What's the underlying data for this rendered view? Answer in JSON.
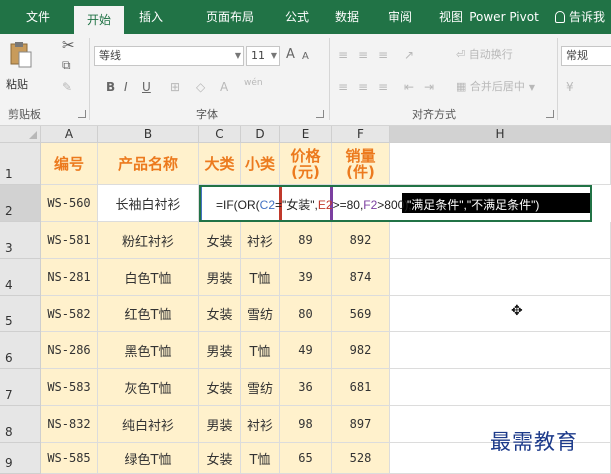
{
  "ribbon_tabs": [
    "文件",
    "开始",
    "插入",
    "页面布局",
    "公式",
    "数据",
    "审阅",
    "视图",
    "Power Pivot",
    "告诉我"
  ],
  "active_tab": "开始",
  "clipboard": {
    "paste_label": "粘贴",
    "group_label": "剪贴板"
  },
  "font": {
    "name": "等线",
    "size": "11",
    "grow": "A",
    "shrink": "A",
    "bold": "B",
    "italic": "I",
    "underline": "U",
    "group_label": "字体",
    "color_a": "A",
    "phonetic": "wén"
  },
  "alignment": {
    "wrap_text": "自动换行",
    "merge_center": "合并后居中",
    "group_label": "对齐方式"
  },
  "number": {
    "format": "常规"
  },
  "columns": [
    "A",
    "B",
    "C",
    "D",
    "E",
    "F",
    "H"
  ],
  "rows": [
    "1",
    "2",
    "3",
    "4",
    "5",
    "6",
    "7",
    "8",
    "9"
  ],
  "headers": [
    "编号",
    "产品名称",
    "大类",
    "小类",
    "价格\n(元)",
    "销量\n(件)"
  ],
  "table": [
    [
      "WS-560",
      "长袖白衬衫",
      "",
      "",
      "",
      ""
    ],
    [
      "WS-581",
      "粉红衬衫",
      "女装",
      "衬衫",
      "89",
      "892"
    ],
    [
      "NS-281",
      "白色T恤",
      "男装",
      "T恤",
      "39",
      "874"
    ],
    [
      "WS-582",
      "红色T恤",
      "女装",
      "雪纺",
      "80",
      "569"
    ],
    [
      "NS-286",
      "黑色T恤",
      "男装",
      "T恤",
      "49",
      "982"
    ],
    [
      "WS-583",
      "灰色T恤",
      "女装",
      "雪纺",
      "36",
      "681"
    ],
    [
      "NS-832",
      "纯白衬衫",
      "男装",
      "衬衫",
      "98",
      "897"
    ],
    [
      "WS-585",
      "绿色T恤",
      "女装",
      "T恤",
      "65",
      "528"
    ]
  ],
  "formula": {
    "prefix": "=IF(OR(",
    "ref_c": "C2",
    "part1": "=\"女装\",",
    "ref_e": "E2",
    "part2": ">=80,",
    "ref_f": "F2",
    "part3": ">800),",
    "tail": "\"满足条件\",\"不满足条件\")"
  },
  "watermark": "最需教育",
  "colors": {
    "excel_green": "#217346",
    "header_orange": "#ec7a1e",
    "cell_yellow": "#fff1cc"
  }
}
